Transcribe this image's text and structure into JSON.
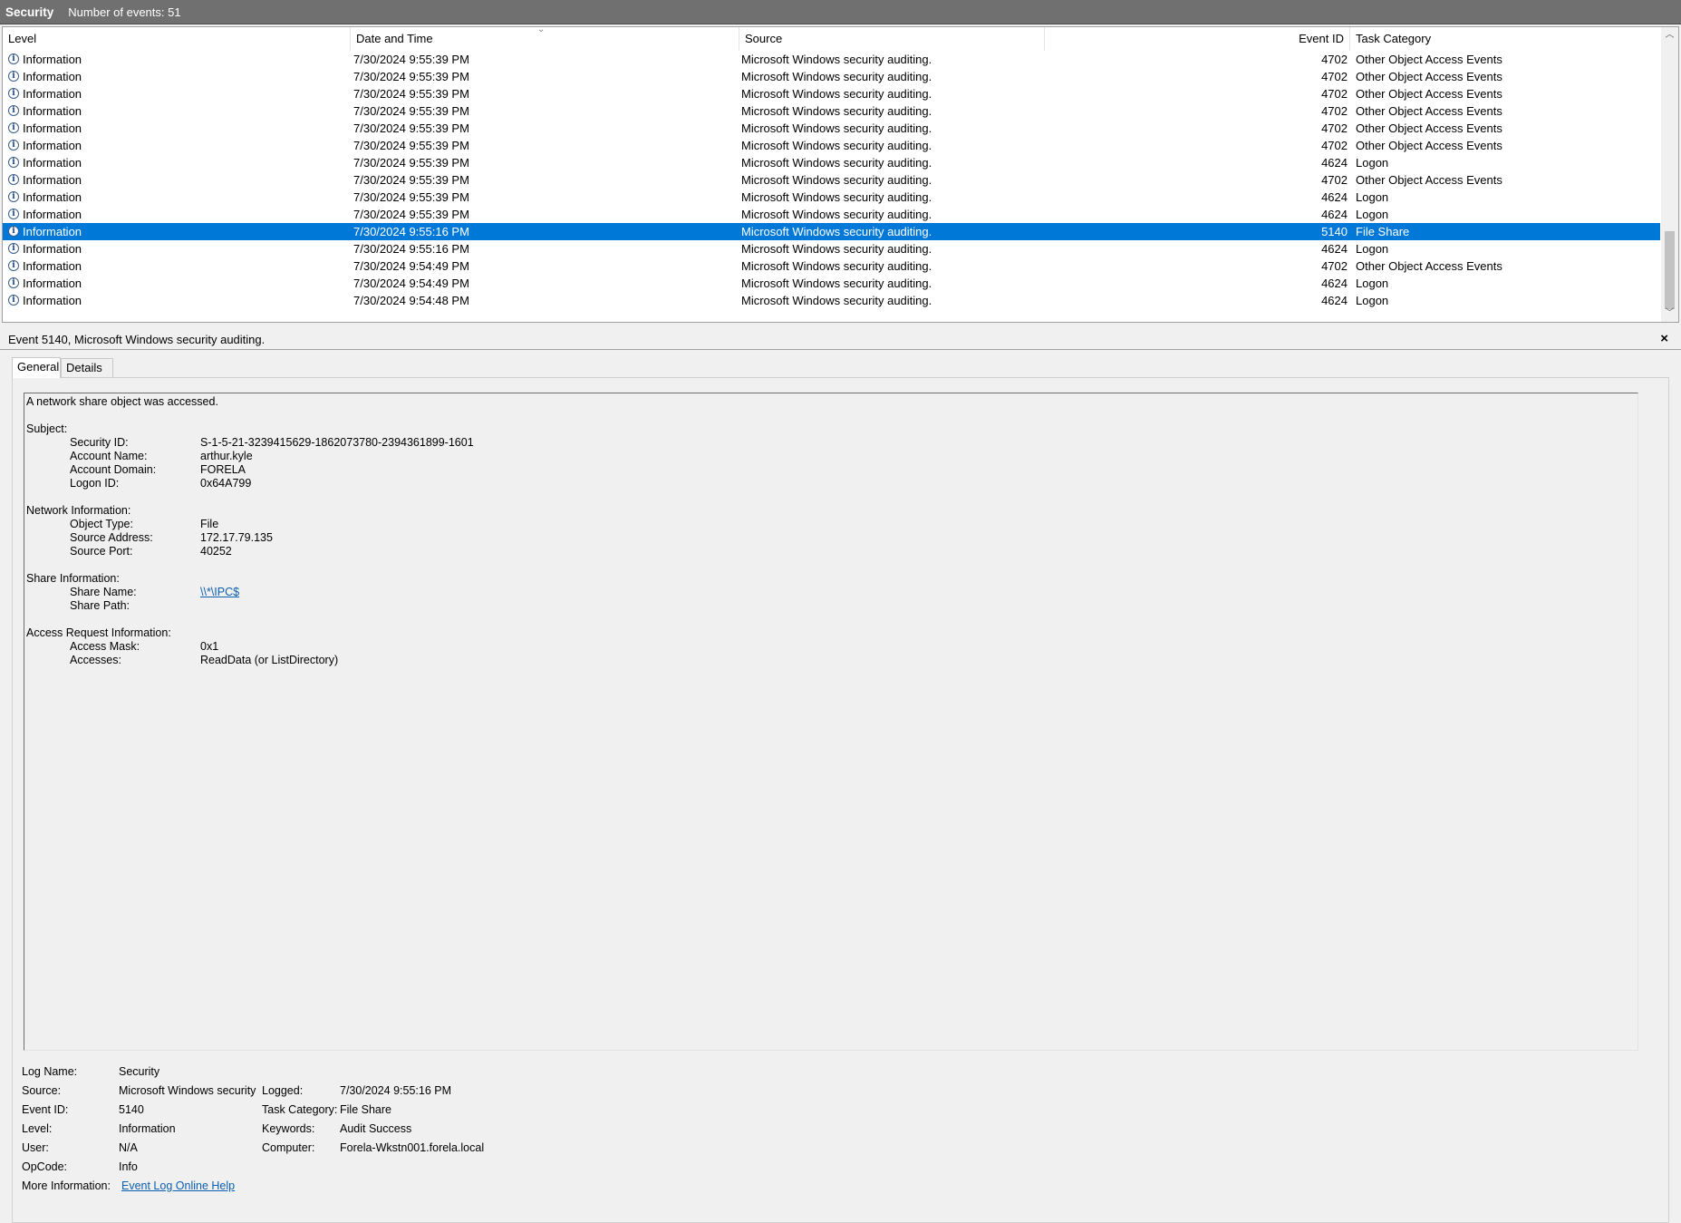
{
  "titlebar": {
    "title": "Security",
    "count_text": "Number of events: 51"
  },
  "grid": {
    "columns": {
      "level": "Level",
      "date": "Date and Time",
      "source": "Source",
      "event_id": "Event ID",
      "category": "Task Category"
    },
    "rows": [
      {
        "level": "Information",
        "date": "7/30/2024 9:55:39 PM",
        "source": "Microsoft Windows security auditing.",
        "event_id": "4702",
        "category": "Other Object Access Events"
      },
      {
        "level": "Information",
        "date": "7/30/2024 9:55:39 PM",
        "source": "Microsoft Windows security auditing.",
        "event_id": "4702",
        "category": "Other Object Access Events"
      },
      {
        "level": "Information",
        "date": "7/30/2024 9:55:39 PM",
        "source": "Microsoft Windows security auditing.",
        "event_id": "4702",
        "category": "Other Object Access Events"
      },
      {
        "level": "Information",
        "date": "7/30/2024 9:55:39 PM",
        "source": "Microsoft Windows security auditing.",
        "event_id": "4702",
        "category": "Other Object Access Events"
      },
      {
        "level": "Information",
        "date": "7/30/2024 9:55:39 PM",
        "source": "Microsoft Windows security auditing.",
        "event_id": "4702",
        "category": "Other Object Access Events"
      },
      {
        "level": "Information",
        "date": "7/30/2024 9:55:39 PM",
        "source": "Microsoft Windows security auditing.",
        "event_id": "4702",
        "category": "Other Object Access Events"
      },
      {
        "level": "Information",
        "date": "7/30/2024 9:55:39 PM",
        "source": "Microsoft Windows security auditing.",
        "event_id": "4624",
        "category": "Logon"
      },
      {
        "level": "Information",
        "date": "7/30/2024 9:55:39 PM",
        "source": "Microsoft Windows security auditing.",
        "event_id": "4702",
        "category": "Other Object Access Events"
      },
      {
        "level": "Information",
        "date": "7/30/2024 9:55:39 PM",
        "source": "Microsoft Windows security auditing.",
        "event_id": "4624",
        "category": "Logon"
      },
      {
        "level": "Information",
        "date": "7/30/2024 9:55:39 PM",
        "source": "Microsoft Windows security auditing.",
        "event_id": "4624",
        "category": "Logon"
      },
      {
        "level": "Information",
        "date": "7/30/2024 9:55:16 PM",
        "source": "Microsoft Windows security auditing.",
        "event_id": "5140",
        "category": "File Share",
        "selected": true
      },
      {
        "level": "Information",
        "date": "7/30/2024 9:55:16 PM",
        "source": "Microsoft Windows security auditing.",
        "event_id": "4624",
        "category": "Logon"
      },
      {
        "level": "Information",
        "date": "7/30/2024 9:54:49 PM",
        "source": "Microsoft Windows security auditing.",
        "event_id": "4702",
        "category": "Other Object Access Events"
      },
      {
        "level": "Information",
        "date": "7/30/2024 9:54:49 PM",
        "source": "Microsoft Windows security auditing.",
        "event_id": "4624",
        "category": "Logon"
      },
      {
        "level": "Information",
        "date": "7/30/2024 9:54:48 PM",
        "source": "Microsoft Windows security auditing.",
        "event_id": "4624",
        "category": "Logon"
      }
    ]
  },
  "detail": {
    "title": "Event 5140, Microsoft Windows security auditing.",
    "close": "×",
    "tabs": {
      "general": "General",
      "details": "Details"
    },
    "message": {
      "summary": "A network share object was accessed.",
      "subject_header": "Subject:",
      "security_id_label": "Security ID:",
      "security_id": "S-1-5-21-3239415629-1862073780-2394361899-1601",
      "account_name_label": "Account Name:",
      "account_name": "arthur.kyle",
      "account_domain_label": "Account Domain:",
      "account_domain": "FORELA",
      "logon_id_label": "Logon ID:",
      "logon_id": "0x64A799",
      "network_header": "Network Information:",
      "object_type_label": "Object Type:",
      "object_type": "File",
      "source_address_label": "Source Address:",
      "source_address": "172.17.79.135",
      "source_port_label": "Source Port:",
      "source_port": "40252",
      "share_header": "Share Information:",
      "share_name_label": "Share Name:",
      "share_name": "\\\\*\\IPC$",
      "share_path_label": "Share Path:",
      "share_path": "",
      "access_header": "Access Request Information:",
      "access_mask_label": "Access Mask:",
      "access_mask": "0x1",
      "accesses_label": "Accesses:",
      "accesses": "ReadData (or ListDirectory)"
    },
    "meta": {
      "log_name_label": "Log Name:",
      "log_name": "Security",
      "source_label": "Source:",
      "source": "Microsoft Windows security",
      "logged_label": "Logged:",
      "logged": "7/30/2024 9:55:16 PM",
      "event_id_label": "Event ID:",
      "event_id": "5140",
      "task_category_label": "Task Category:",
      "task_category": "File Share",
      "level_label": "Level:",
      "level": "Information",
      "keywords_label": "Keywords:",
      "keywords": "Audit Success",
      "user_label": "User:",
      "user": "N/A",
      "computer_label": "Computer:",
      "computer": "Forela-Wkstn001.forela.local",
      "opcode_label": "OpCode:",
      "opcode": "Info",
      "more_info_label": "More Information:",
      "more_info_link": "Event Log Online Help"
    }
  }
}
